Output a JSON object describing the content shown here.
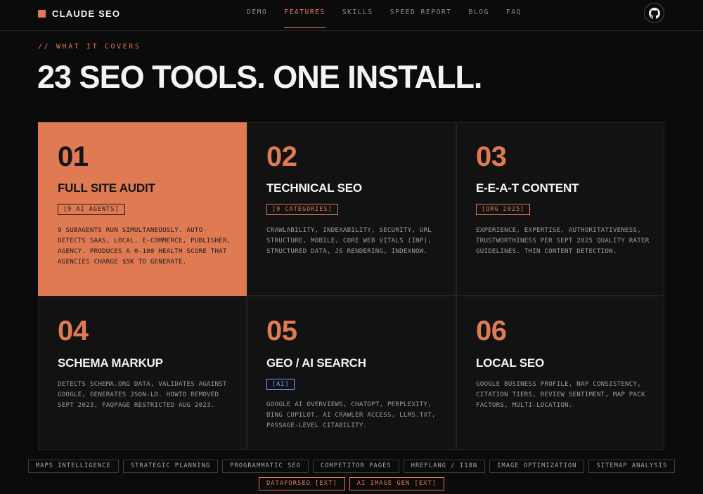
{
  "brand": {
    "name": "CLAUDE SEO",
    "accent": "#e07a52"
  },
  "nav": {
    "links": [
      {
        "label": "DEMO",
        "active": false
      },
      {
        "label": "FEATURES",
        "active": true
      },
      {
        "label": "SKILLS",
        "active": false
      },
      {
        "label": "SPEED REPORT",
        "active": false
      },
      {
        "label": "BLOG",
        "active": false
      },
      {
        "label": "FAQ",
        "active": false
      }
    ],
    "github_icon": "github-icon"
  },
  "hero": {
    "eyebrow": "// WHAT IT COVERS",
    "headline": "23 SEO TOOLS. ONE INSTALL."
  },
  "cards": [
    {
      "num": "01",
      "title": "FULL SITE AUDIT",
      "tag": "[9 AI AGENTS]",
      "desc": "9 SUBAGENTS RUN SIMULTANEOUSLY. AUTO-DETECTS SAAS, LOCAL, E-COMMERCE, PUBLISHER, AGENCY. PRODUCES A 0-100 HEALTH SCORE THAT AGENCIES CHARGE $5K TO GENERATE."
    },
    {
      "num": "02",
      "title": "TECHNICAL SEO",
      "tag": "[9 CATEGORIES]",
      "desc": "CRAWLABILITY, INDEXABILITY, SECURITY, URL STRUCTURE, MOBILE, CORE WEB VITALS (INP), STRUCTURED DATA, JS RENDERING, INDEXNOW."
    },
    {
      "num": "03",
      "title": "E-E-A-T CONTENT",
      "tag": "[QRG 2025]",
      "desc": "EXPERIENCE, EXPERTISE, AUTHORITATIVENESS, TRUSTWORTHINESS PER SEPT 2025 QUALITY RATER GUIDELINES. THIN CONTENT DETECTION."
    },
    {
      "num": "04",
      "title": "SCHEMA MARKUP",
      "tag": "",
      "desc": "DETECTS SCHEMA.ORG DATA, VALIDATES AGAINST GOOGLE, GENERATES JSON-LD. HOWTO REMOVED SEPT 2023, FAQPAGE RESTRICTED AUG 2023."
    },
    {
      "num": "05",
      "title": "GEO / AI SEARCH",
      "tag": "[AI]",
      "desc": "GOOGLE AI OVERVIEWS, CHATGPT, PERPLEXITY, BING COPILOT. AI CRAWLER ACCESS, LLMS.TXT, PASSAGE-LEVEL CITABILITY."
    },
    {
      "num": "06",
      "title": "LOCAL SEO",
      "tag": "",
      "desc": "GOOGLE BUSINESS PROFILE, NAP CONSISTENCY, CITATION TIERS, REVIEW SENTIMENT, MAP PACK FACTORS, MULTI-LOCATION."
    }
  ],
  "pills": {
    "row1": [
      "MAPS INTELLIGENCE",
      "STRATEGIC PLANNING",
      "PROGRAMMATIC SEO",
      "COMPETITOR PAGES",
      "HREFLANG / I18N",
      "IMAGE OPTIMIZATION",
      "SITEMAP ANALYSIS"
    ],
    "row2": [
      "DATAFORSEO [EXT]",
      "AI IMAGE GEN [EXT]"
    ]
  }
}
